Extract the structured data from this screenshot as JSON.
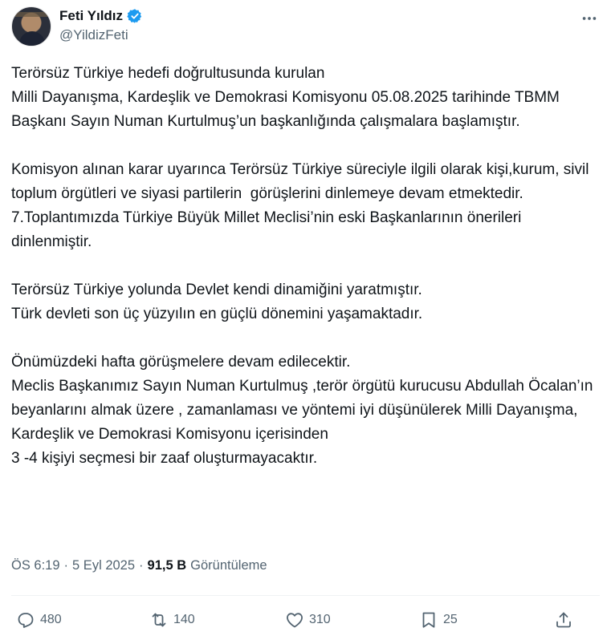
{
  "author": {
    "display_name": "Feti Yıldız",
    "handle": "@YildizFeti",
    "verified_color": "#1d9bf0"
  },
  "tweet": {
    "paragraphs": [
      "Terörsüz Türkiye hedefi doğrultusunda kurulan\nMilli Dayanışma, Kardeşlik ve Demokrasi Komisyonu 05.08.2025 tarihinde TBMM Başkanı Sayın Numan Kurtulmuş’un başkanlığında çalışmalara başlamıştır.",
      "Komisyon alınan karar uyarınca Terörsüz Türkiye süreciyle ilgili olarak kişi,kurum, sivil toplum örgütleri ve siyasi partilerin  görüşlerini dinlemeye devam etmektedir.\n7.Toplantımızda Türkiye Büyük Millet Meclisi’nin eski Başkanlarının önerileri dinlenmiştir.",
      "Terörsüz Türkiye yolunda Devlet kendi dinamiğini yaratmıştır.\nTürk devleti son üç yüzyılın en güçlü dönemini yaşamaktadır.",
      "Önümüzdeki hafta görüşmelere devam edilecektir.\nMeclis Başkanımız Sayın Numan Kurtulmuş ,terör örgütü kurucusu Abdullah Öcalan’ın beyanlarını almak üzere , zamanlaması ve yöntemi iyi düşünülerek Milli Dayanışma, Kardeşlik ve Demokrasi Komisyonu içerisinden\n3 -4 kişiyi seçmesi bir zaaf oluşturmayacaktır."
    ]
  },
  "meta": {
    "time": "ÖS 6:19",
    "separator": "·",
    "date": "5 Eyl 2025",
    "views_count": "91,5 B",
    "views_label": "Görüntüleme"
  },
  "actions": {
    "reply_count": "480",
    "retweet_count": "140",
    "like_count": "310",
    "bookmark_count": "25"
  }
}
